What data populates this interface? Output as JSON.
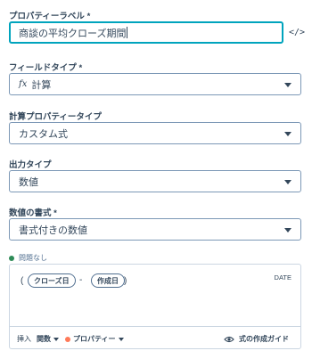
{
  "property_label": {
    "label": "プロパティーラベル *",
    "value": "商談の平均クローズ期間",
    "code_toggle_icon": "code-icon"
  },
  "field_type": {
    "label": "フィールドタイプ *",
    "icon_text": "fx",
    "value": "計算"
  },
  "calc_property_type": {
    "label": "計算プロパティータイプ",
    "value": "カスタム式"
  },
  "output_type": {
    "label": "出力タイプ",
    "value": "数値"
  },
  "number_format": {
    "label": "数値の書式 *",
    "value": "書式付きの数値"
  },
  "status": {
    "text": "問題なし",
    "color": "#2e8b57"
  },
  "formula": {
    "open_paren": "(",
    "token1": "クローズ日",
    "operator": "-",
    "token2": "作成日",
    "close_paren": ")",
    "type_tag": "DATE"
  },
  "editor_footer": {
    "insert_label": "挿入",
    "functions": "関数",
    "properties": "プロパティー",
    "guide": "式の作成ガイド"
  }
}
